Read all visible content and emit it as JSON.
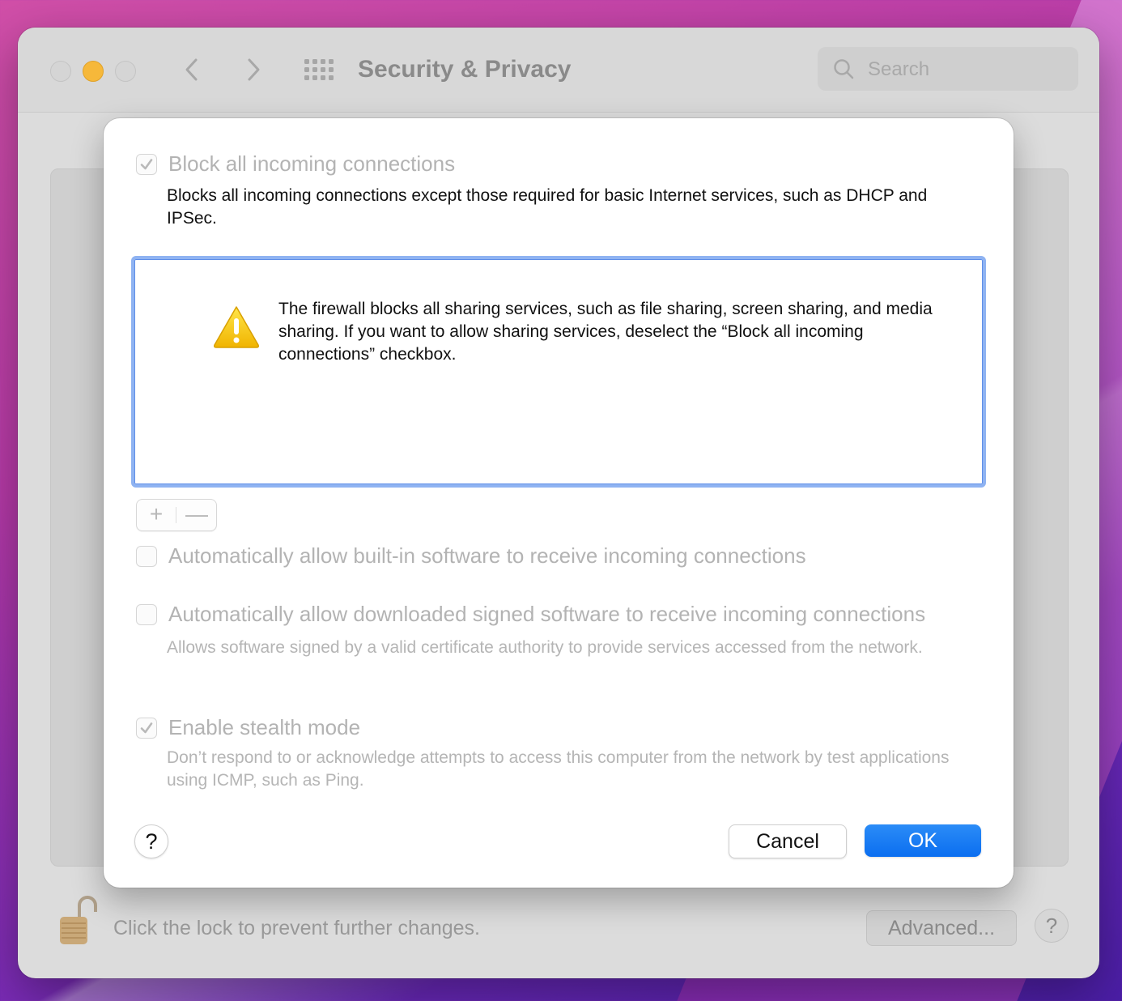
{
  "window": {
    "title": "Security & Privacy",
    "search_placeholder": "Search"
  },
  "sheet": {
    "block_all": {
      "label": "Block all incoming connections",
      "checked": true,
      "description": "Blocks all incoming connections except those required for basic Internet services, such as DHCP and IPSec."
    },
    "warning": {
      "icon": "warning-icon",
      "text": "The firewall blocks all sharing services, such as file sharing, screen sharing, and media sharing. If you want to allow sharing services, deselect the “Block all incoming connections” checkbox."
    },
    "add_label": "+",
    "remove_label": "—",
    "auto_builtin": {
      "label": "Automatically allow built-in software to receive incoming connections",
      "checked": false
    },
    "auto_signed": {
      "label": "Automatically allow downloaded signed software to receive incoming connections",
      "checked": false,
      "description": "Allows software signed by a valid certificate authority to provide services accessed from the network."
    },
    "stealth": {
      "label": "Enable stealth mode",
      "checked": true,
      "description": "Don’t respond to or acknowledge attempts to access this computer from the network by test applications using ICMP, such as Ping."
    },
    "help_label": "?",
    "cancel_label": "Cancel",
    "ok_label": "OK"
  },
  "footer": {
    "lock_text": "Click the lock to prevent further changes.",
    "advanced_label": "Advanced...",
    "help_label": "?"
  },
  "colors": {
    "accent": "#0b6ef0",
    "warning": "#f5c400",
    "traffic_minimize": "#f6b83a"
  }
}
